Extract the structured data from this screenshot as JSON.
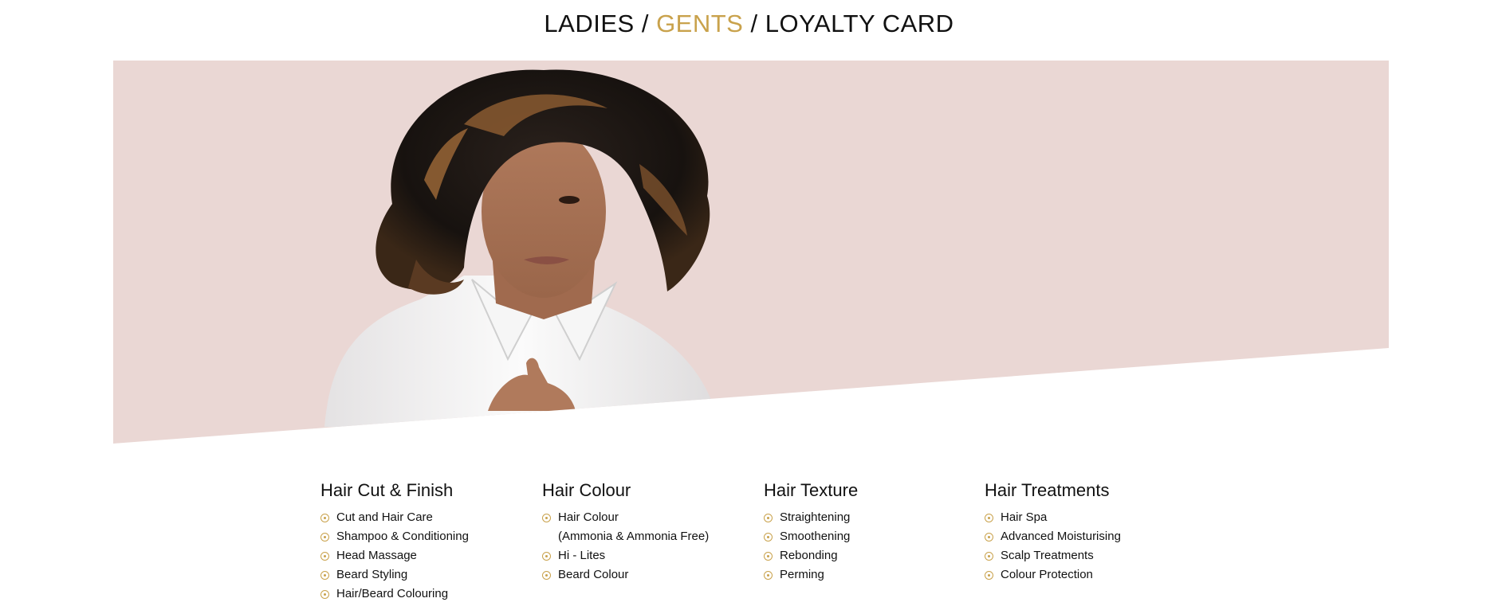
{
  "nav": {
    "ladies": "LADIES",
    "gents": "GENTS",
    "loyalty": "LOYALTY CARD",
    "separator": "/",
    "active_color": "#c9a24c"
  },
  "hero": {
    "background_color": "#ead7d4",
    "image": "man-with-long-highlighted-hair-white-shirt"
  },
  "services": [
    {
      "title": "Hair Cut & Finish",
      "items": [
        "Cut and Hair Care",
        "Shampoo & Conditioning",
        "Head Massage",
        "Beard Styling",
        "Hair/Beard Colouring"
      ]
    },
    {
      "title": "Hair Colour",
      "items": [
        "Hair Colour",
        "(Ammonia & Ammonia Free)",
        "Hi - Lites",
        "Beard Colour"
      ]
    },
    {
      "title": "Hair Texture",
      "items": [
        "Straightening",
        "Smoothening",
        "Rebonding",
        "Perming"
      ]
    },
    {
      "title": "Hair Treatments",
      "items": [
        "Hair Spa",
        "Advanced Moisturising",
        "Scalp Treatments",
        "Colour Protection"
      ]
    }
  ]
}
